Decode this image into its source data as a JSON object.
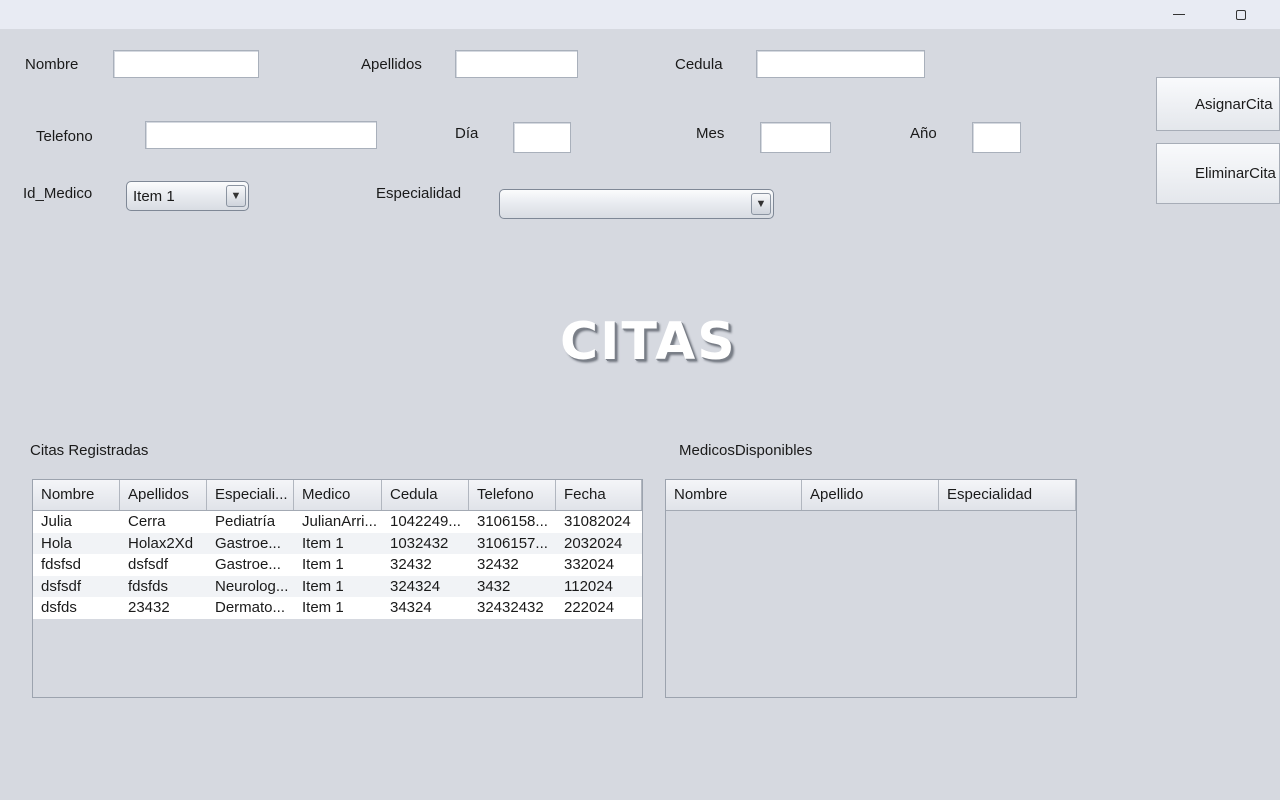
{
  "form": {
    "nombre_label": "Nombre",
    "apellidos_label": "Apellidos",
    "cedula_label": "Cedula",
    "telefono_label": "Telefono",
    "dia_label": "Día",
    "mes_label": "Mes",
    "anio_label": "Año",
    "id_medico_label": "Id_Medico",
    "id_medico_value": "Item 1",
    "especialidad_label": "Especialidad",
    "especialidad_value": ""
  },
  "buttons": {
    "asignar": "AsignarCita",
    "eliminar": "EliminarCita"
  },
  "heading": "CITAS",
  "citas": {
    "title": "Citas Registradas",
    "columns": [
      "Nombre",
      "Apellidos",
      "Especiali...",
      "Medico",
      "Cedula",
      "Telefono",
      "Fecha"
    ],
    "rows": [
      [
        "Julia",
        "Cerra",
        "Pediatría",
        "JulianArri...",
        "1042249...",
        "3106158...",
        "31082024"
      ],
      [
        "Hola",
        "Holax2Xd",
        "Gastroe...",
        "Item 1",
        "1032432",
        "3106157...",
        "2032024"
      ],
      [
        "fdsfsd",
        "dsfsdf",
        "Gastroe...",
        "Item 1",
        "32432",
        "32432",
        "332024"
      ],
      [
        "dsfsdf",
        "fdsfds",
        "Neurolog...",
        "Item 1",
        "324324",
        "3432",
        "112024"
      ],
      [
        "dsfds",
        "23432",
        "Dermato...",
        "Item 1",
        "34324",
        "32432432",
        "222024"
      ]
    ]
  },
  "medicos": {
    "title": "MedicosDisponibles",
    "columns": [
      "Nombre",
      "Apellido",
      "Especialidad"
    ]
  }
}
